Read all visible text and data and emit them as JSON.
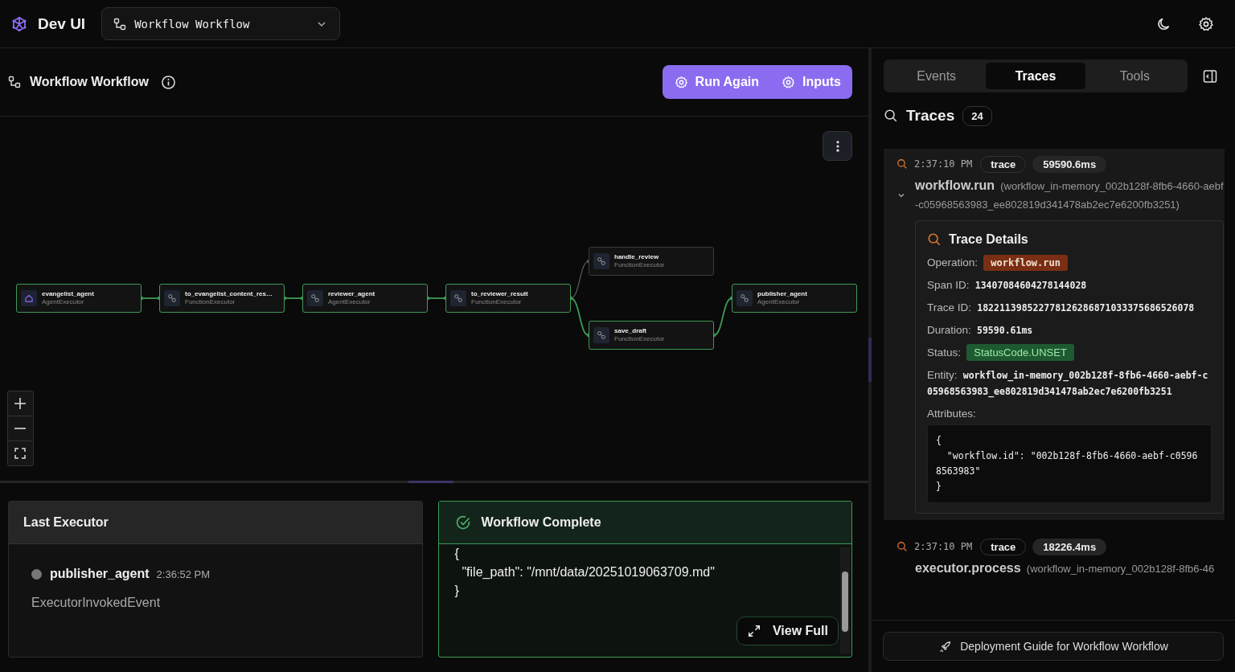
{
  "app": {
    "title": "Dev UI",
    "workflow_selector": "Workflow Workflow"
  },
  "workflow": {
    "title": "Workflow Workflow",
    "actions": [
      {
        "label": "Run Again"
      },
      {
        "label": "Inputs"
      }
    ]
  },
  "graph": {
    "nodes": [
      {
        "name": "evangelist_agent",
        "type": "AgentExecutor",
        "kind": "start",
        "active": true
      },
      {
        "name": "to_evangelist_content_res…",
        "type": "FunctionExecutor",
        "kind": "step",
        "active": true
      },
      {
        "name": "reviewer_agent",
        "type": "AgentExecutor",
        "kind": "step",
        "active": true
      },
      {
        "name": "to_reviewer_result",
        "type": "FunctionExecutor",
        "kind": "step",
        "active": true
      },
      {
        "name": "handle_review",
        "type": "FunctionExecutor",
        "kind": "step",
        "active": false
      },
      {
        "name": "save_draft",
        "type": "FunctionExecutor",
        "kind": "step",
        "active": true
      },
      {
        "name": "publisher_agent",
        "type": "AgentExecutor",
        "kind": "step",
        "active": true
      }
    ],
    "edges": [
      {
        "active": true
      },
      {
        "active": true
      },
      {
        "active": true
      },
      {
        "active": false
      },
      {
        "active": true
      },
      {
        "active": true
      }
    ]
  },
  "last_executor": {
    "title": "Last Executor",
    "name": "publisher_agent",
    "time": "2:36:52 PM",
    "event": "ExecutorInvokedEvent"
  },
  "result": {
    "title": "Workflow Complete",
    "lines": [
      "{",
      "  \"file_path\": \"/mnt/data/20251019063709.md\"",
      "}"
    ],
    "button": "View Full"
  },
  "sidebar": {
    "tabs": [
      {
        "label": "Events",
        "selected": false
      },
      {
        "label": "Traces",
        "selected": true
      },
      {
        "label": "Tools",
        "selected": false
      }
    ],
    "header": "Traces",
    "count": "24",
    "traces": [
      {
        "time": "2:37:10 PM",
        "tag": "trace",
        "duration": "59590.6ms",
        "name": "workflow.run",
        "entity": "(workflow_in-memory_002b128f-8fb6-4660-aebf-c05968563983_ee802819d341478ab2ec7e6200fb3251)",
        "expanded": true,
        "details": {
          "title": "Trace Details",
          "fields": [
            {
              "label": "Operation:",
              "value": "workflow.run",
              "kind": "operation"
            },
            {
              "label": "Span ID:",
              "value": "13407084604278144028",
              "kind": "plain"
            },
            {
              "label": "Trace ID:",
              "value": "182211398522778126286871033375686526078",
              "kind": "plain"
            },
            {
              "label": "Duration:",
              "value": "59590.61ms",
              "kind": "plain"
            },
            {
              "label": "Status:",
              "value": "StatusCode.UNSET",
              "kind": "status"
            },
            {
              "label": "Entity:",
              "value": "workflow_in-memory_002b128f-8fb6-4660-aebf-c05968563983_ee802819d341478ab2ec7e6200fb3251",
              "kind": "plain"
            }
          ],
          "attributes_label": "Attributes:",
          "attributes": [
            "{",
            "  \"workflow.id\": \"002b128f-8fb6-4660-aebf-c05968563983\"",
            "}"
          ]
        }
      },
      {
        "time": "2:37:10 PM",
        "tag": "trace",
        "duration": "18226.4ms",
        "name": "executor.process",
        "entity": "(workflow_in-memory_002b128f-8fb6-46",
        "expanded": false
      }
    ],
    "footer_button": "Deployment Guide for Workflow Workflow"
  }
}
